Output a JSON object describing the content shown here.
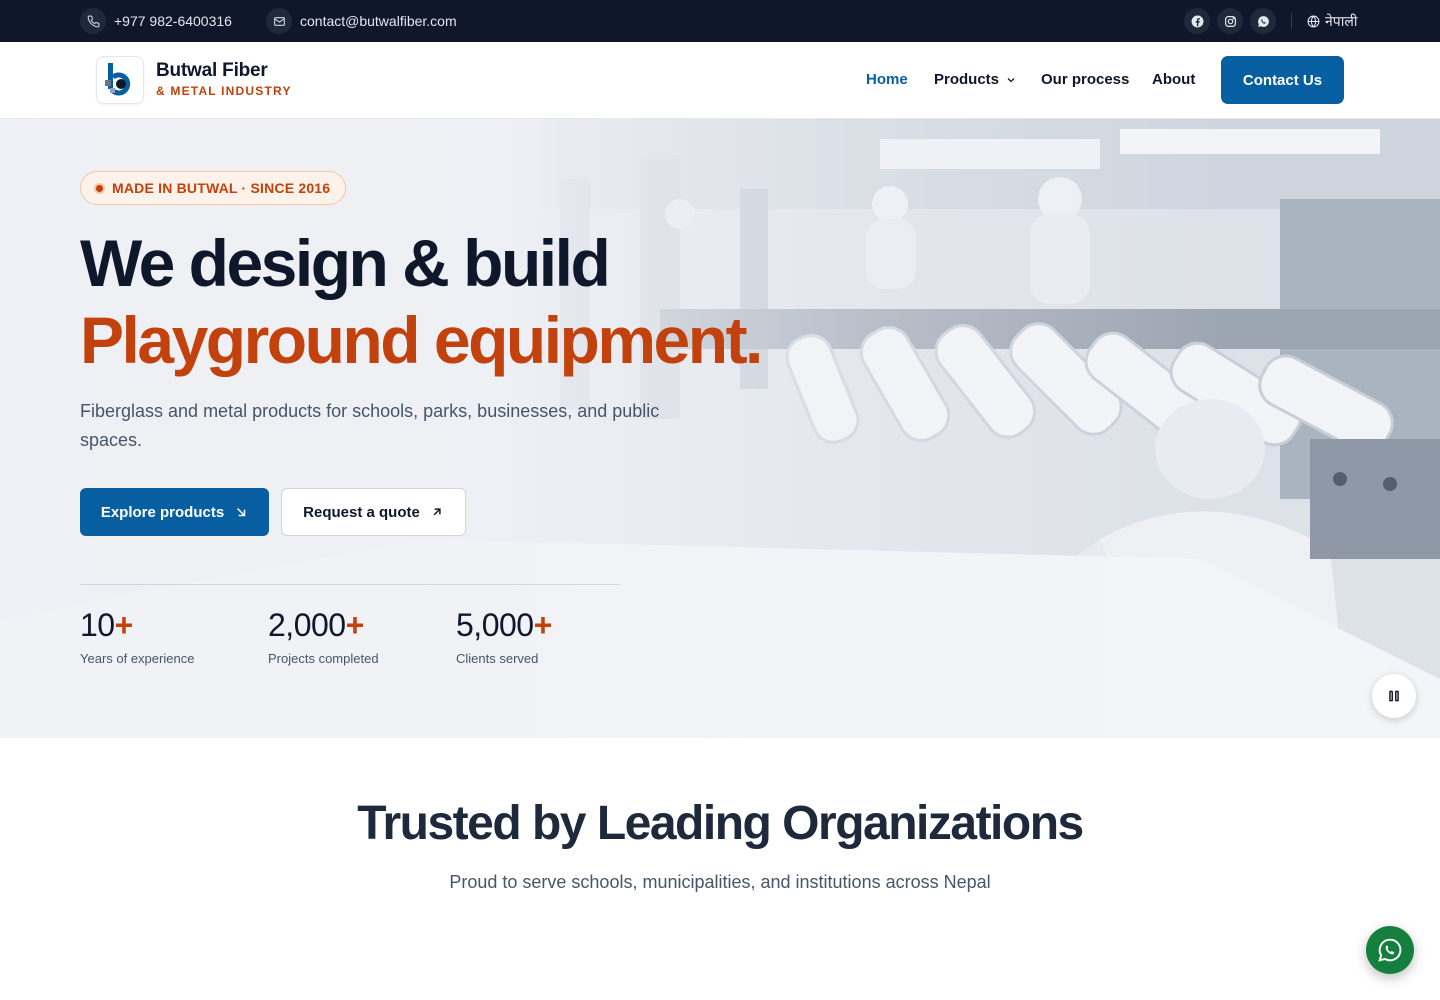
{
  "topbar": {
    "phone": "+977 982-6400316",
    "email": "contact@butwalfiber.com",
    "social_icons": [
      "facebook-icon",
      "instagram-icon",
      "whatsapp-icon"
    ],
    "language_label": "नेपाली"
  },
  "nav": {
    "brand_name": "Butwal Fiber",
    "brand_subtitle": "& METAL INDUSTRY",
    "links": [
      {
        "label": "Home",
        "active": true
      },
      {
        "label": "Products",
        "has_dropdown": true
      },
      {
        "label": "Our process"
      },
      {
        "label": "About"
      }
    ],
    "cta_label": "Contact Us"
  },
  "hero": {
    "badge": "MADE IN BUTWAL · SINCE 2016",
    "headline_line1": "We design & build",
    "headline_line2": "Playground equipment.",
    "lead": "Fiberglass and metal products for schools, parks, businesses, and public spaces.",
    "primary_button": "Explore products",
    "secondary_button": "Request a quote",
    "stats": [
      {
        "value": "10",
        "suffix": "+",
        "label": "Years of experience"
      },
      {
        "value": "2,000",
        "suffix": "+",
        "label": "Projects completed"
      },
      {
        "value": "5,000",
        "suffix": "+",
        "label": "Clients served"
      }
    ]
  },
  "trusted": {
    "title": "Trusted by Leading Organizations",
    "subtitle": "Proud to serve schools, municipalities, and institutions across Nepal"
  },
  "colors": {
    "brand_blue": "#075ea0",
    "accent_orange": "#c2410c",
    "topbar_bg": "#0f172a",
    "whatsapp_green": "#15803d"
  }
}
